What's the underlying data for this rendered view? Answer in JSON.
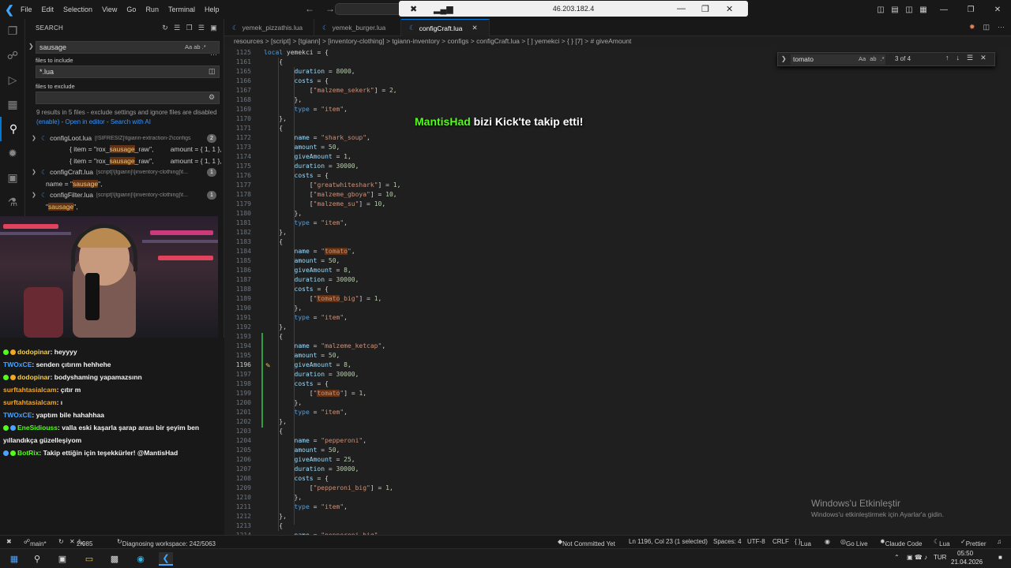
{
  "titlebar": {
    "menu": [
      "File",
      "Edit",
      "Selection",
      "View",
      "Go",
      "Run",
      "Terminal",
      "Help"
    ],
    "remote_ip": "46.203.182.4"
  },
  "sidebar": {
    "title": "SEARCH",
    "search_value": "sausage",
    "files_include_label": "files to include",
    "files_include_value": "*.lua",
    "files_exclude_label": "files to exclude",
    "results_msg": "9 results in 5 files - exclude settings and ignore files are disabled",
    "enable_link": "(enable)",
    "open_editor_link": "Open in editor",
    "search_ai_link": "Search with AI",
    "files": [
      {
        "name": "configLoot.lua",
        "path": "[!SIFRESIZ]\\tgiann-extraction-2\\configs",
        "count": "2"
      },
      {
        "name": "configCraft.lua",
        "path": "[script]\\[tgiann]\\[inventory-clothing]\\t...",
        "count": "1"
      },
      {
        "name": "configFilter.lua",
        "path": "[script]\\[tgiann]\\[inventory-clothing]\\t...",
        "count": "1"
      }
    ],
    "matches": [
      {
        "pre": "{ item = \"rox_",
        "hl": "sausage",
        "post": "_raw\",         amount = { 1, 1 },"
      },
      {
        "pre": "{ item = \"rox_",
        "hl": "sausage",
        "post": "_raw\",         amount = { 1, 1 },"
      },
      {
        "pre": "name = \"",
        "hl": "sausage",
        "post": "\","
      },
      {
        "pre": "\"",
        "hl": "sausage",
        "post": "\","
      }
    ]
  },
  "chat": [
    {
      "user": "dodopinar",
      "text": ": heyyyy",
      "color": "#f5d142"
    },
    {
      "user": "TWOxCE",
      "text": ": senden çıtırım hehhehe",
      "color": "#4aa3ff"
    },
    {
      "user": "dodopinar",
      "text": ": bodyshaming yapamazsınn",
      "color": "#f5d142"
    },
    {
      "user": "surftahtasialcam",
      "text": ": çıtır m",
      "color": "#f5a623"
    },
    {
      "user": "surftahtasialcam",
      "text": ": ı",
      "color": "#f5a623"
    },
    {
      "user": "TWOxCE",
      "text": ": yaptım bile hahahhaa",
      "color": "#4aa3ff"
    },
    {
      "user": "EneSidiouss",
      "text": ": valla eski kaşarla şarap arası bir şeyim ben",
      "color": "#53fc18"
    },
    {
      "user": "",
      "text": "yıllandıkça güzelleşiyom",
      "color": "#ffffff"
    },
    {
      "user": "BotRix",
      "text": ": Takip ettiğin için teşekkürler! @MantisHad",
      "color": "#53fc18"
    }
  ],
  "tabs": [
    "yemek_pizzathis.lua",
    "yemek_burger.lua",
    "configCraft.lua"
  ],
  "breadcrumb": "resources  >  [script]  >  [tgiann]  >  [inventory-clothing]  >  tgiann-inventory  >  configs  >  configCraft.lua  >  [ ] yemekci  >  { } [7]  >  # giveAmount",
  "find": {
    "query": "tomato",
    "count": "3 of 4"
  },
  "overlay": {
    "user": "MantisHad",
    "text": " bizi Kick'te takip etti!"
  },
  "watermark": {
    "title": "Windows'u Etkinleştir",
    "sub": "Windows'u etkinleştirmek için Ayarlar'a gidin."
  },
  "status": {
    "branch": "main*",
    "errors": "2K",
    "warnings": "985",
    "diag": "Diagnosing workspace: 242/5063",
    "commit": "Not Committed Yet",
    "pos": "Ln 1196, Col 23 (1 selected)",
    "spaces": "Spaces: 4",
    "enc": "UTF-8",
    "eol": "CRLF",
    "lang": "Lua",
    "golive": "Go Live",
    "claude": "Claude Code",
    "lua2": "Lua",
    "prettier": "Prettier"
  },
  "taskbar": {
    "lang": "TUR",
    "time": "05:50",
    "date": "21.04.2026"
  },
  "code_lines": [
    {
      "n": "1125",
      "t": "local yemekci = {"
    },
    {
      "n": "1161",
      "t": "    {"
    },
    {
      "n": "1165",
      "t": "        duration = 8000,"
    },
    {
      "n": "1166",
      "t": "        costs = {"
    },
    {
      "n": "1167",
      "t": "            [\"malzeme_sekerk\"] = 2,"
    },
    {
      "n": "1168",
      "t": "        },"
    },
    {
      "n": "1169",
      "t": "        type = \"item\","
    },
    {
      "n": "1170",
      "t": "    },"
    },
    {
      "n": "1171",
      "t": "    {"
    },
    {
      "n": "1172",
      "t": "        name = \"shark_soup\","
    },
    {
      "n": "1173",
      "t": "        amount = 50,"
    },
    {
      "n": "1174",
      "t": "        giveAmount = 1,"
    },
    {
      "n": "1175",
      "t": "        duration = 30000,"
    },
    {
      "n": "1176",
      "t": "        costs = {"
    },
    {
      "n": "1177",
      "t": "            [\"greatwhiteshark\"] = 1,"
    },
    {
      "n": "1178",
      "t": "            [\"malzeme_gboya\"] = 10,"
    },
    {
      "n": "1179",
      "t": "            [\"malzeme_su\"] = 10,"
    },
    {
      "n": "1180",
      "t": "        },"
    },
    {
      "n": "1181",
      "t": "        type = \"item\","
    },
    {
      "n": "1182",
      "t": "    },"
    },
    {
      "n": "1183",
      "t": "    {"
    },
    {
      "n": "1184",
      "t": "        name = \"tomato\","
    },
    {
      "n": "1185",
      "t": "        amount = 50,"
    },
    {
      "n": "1186",
      "t": "        giveAmount = 8,"
    },
    {
      "n": "1187",
      "t": "        duration = 30000,"
    },
    {
      "n": "1188",
      "t": "        costs = {"
    },
    {
      "n": "1189",
      "t": "            [\"tomato_big\"] = 1,"
    },
    {
      "n": "1190",
      "t": "        },"
    },
    {
      "n": "1191",
      "t": "        type = \"item\","
    },
    {
      "n": "1192",
      "t": "    },"
    },
    {
      "n": "1193",
      "t": "    {"
    },
    {
      "n": "1194",
      "t": "        name = \"malzeme_ketcap\","
    },
    {
      "n": "1195",
      "t": "        amount = 50,"
    },
    {
      "n": "1196",
      "t": "        giveAmount = 8,"
    },
    {
      "n": "1197",
      "t": "        duration = 30000,"
    },
    {
      "n": "1198",
      "t": "        costs = {"
    },
    {
      "n": "1199",
      "t": "            [\"tomato\"] = 1,"
    },
    {
      "n": "1200",
      "t": "        },"
    },
    {
      "n": "1201",
      "t": "        type = \"item\","
    },
    {
      "n": "1202",
      "t": "    },"
    },
    {
      "n": "1203",
      "t": "    {"
    },
    {
      "n": "1204",
      "t": "        name = \"pepperoni\","
    },
    {
      "n": "1205",
      "t": "        amount = 50,"
    },
    {
      "n": "1206",
      "t": "        giveAmount = 25,"
    },
    {
      "n": "1207",
      "t": "        duration = 30000,"
    },
    {
      "n": "1208",
      "t": "        costs = {"
    },
    {
      "n": "1209",
      "t": "            [\"pepperoni_big\"] = 1,"
    },
    {
      "n": "1210",
      "t": "        },"
    },
    {
      "n": "1211",
      "t": "        type = \"item\","
    },
    {
      "n": "1212",
      "t": "    },"
    },
    {
      "n": "1213",
      "t": "    {"
    },
    {
      "n": "1214",
      "t": "        name = \"pepperoni_big\","
    }
  ],
  "current_line": "1196"
}
